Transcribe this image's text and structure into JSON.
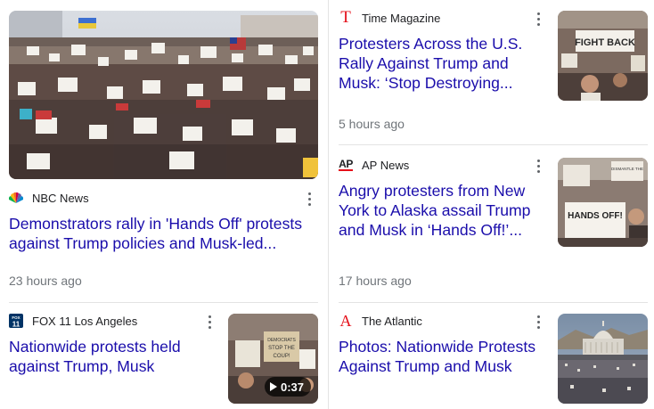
{
  "articles": [
    {
      "source": "NBC News",
      "headline_lines": [
        "Demonstrators rally in 'Hands Off' protests",
        "against Trump policies and Musk-led..."
      ],
      "time": "23 hours ago",
      "logo": "nbc-peacock-icon"
    },
    {
      "source": "FOX 11 Los Angeles",
      "logo_text": "FOX 11",
      "headline_lines": [
        "Nationwide protests held",
        "against Trump, Musk"
      ],
      "video_duration": "0:37",
      "logo": "fox11-logo-icon"
    },
    {
      "source": "Time Magazine",
      "logo_text": "T",
      "headline_lines": [
        "Protesters Across the U.S.",
        "Rally Against Trump and",
        "Musk: ‘Stop Destroying..."
      ],
      "time": "5 hours ago",
      "logo": "time-t-icon"
    },
    {
      "source": "AP News",
      "logo_text": "AP",
      "headline_lines": [
        "Angry protesters from New",
        "York to Alaska assail Trump",
        "and Musk in ‘Hands Off!’..."
      ],
      "time": "17 hours ago",
      "logo": "ap-logo-icon"
    },
    {
      "source": "The Atlantic",
      "logo_text": "A",
      "headline_lines": [
        "Photos: Nationwide Protests",
        "Against Trump and Musk"
      ],
      "logo": "atlantic-a-icon"
    }
  ],
  "thumb_text": {
    "fight_back": "FIGHT BACK",
    "hands_off": "HANDS OFF!",
    "dismantle": "DISMANTLE THE",
    "dems": "DEMOCRATS STOP THE COUP!"
  },
  "colors": {
    "link": "#1a0dab",
    "meta": "#70757a",
    "divider": "#e3e3e3"
  }
}
